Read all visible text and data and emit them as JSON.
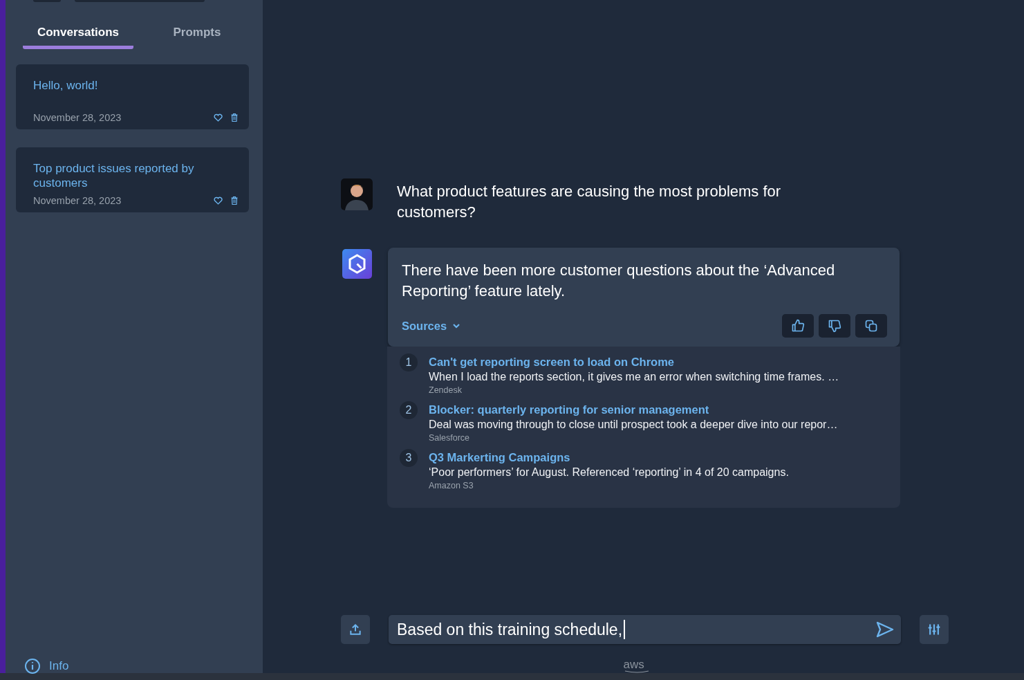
{
  "sidebar": {
    "tabs": [
      {
        "label": "Conversations",
        "selected": true
      },
      {
        "label": "Prompts",
        "selected": false
      }
    ],
    "conversations": [
      {
        "title": "Hello, world!",
        "date": "November 28, 2023"
      },
      {
        "title": "Top product issues reported by customers",
        "date": "November 28, 2023"
      }
    ],
    "info_link": "Info"
  },
  "chat": {
    "messages": [
      {
        "kind": "user",
        "text": "What product features are causing the most problems for customers?"
      },
      {
        "kind": "assistant",
        "text": "There have been more customer questions about the ‘Advanced Reporting’ feature lately.",
        "sources_toggle": "Sources",
        "sources_expanded": true,
        "sources": [
          {
            "number": "1",
            "title": "Can't get reporting screen to load on Chrome",
            "snippet": "When I load the reports section, it gives me an error when switching time frames. …",
            "origin": "Zendesk"
          },
          {
            "number": "2",
            "title": "Blocker: quarterly reporting for senior management",
            "snippet": "Deal was moving through to close until prospect took a deeper dive into our repor…",
            "origin": "Salesforce"
          },
          {
            "number": "3",
            "title": "Q3 Markerting Campaigns",
            "snippet": "‘Poor performers’ for August. Referenced ‘reporting’ in 4 of 20 campaigns.",
            "origin": "Amazon S3"
          }
        ]
      }
    ]
  },
  "composer": {
    "value": "Based on this training schedule,"
  },
  "footer": {
    "logo": "aws"
  }
}
